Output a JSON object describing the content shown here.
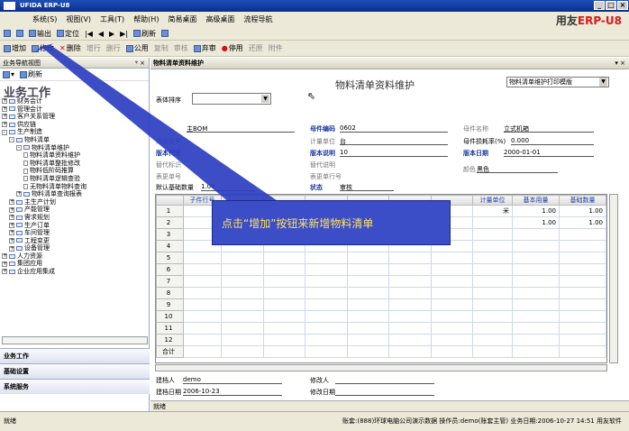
{
  "window": {
    "title": "UFIDA ERP-U8",
    "brand_prefix": "用友",
    "brand_main": "ERP-U8"
  },
  "menu": [
    "系统(S)",
    "视图(V)",
    "工具(T)",
    "帮助(H)",
    "简易桌面",
    "高级桌面",
    "流程导航"
  ],
  "toolbar1": [
    "输出",
    "定位",
    "刷新"
  ],
  "toolbar2": [
    "增加",
    "修改",
    "删除",
    "增行",
    "删行",
    "公用",
    "复制",
    "审核",
    "弃审",
    "停用",
    "还原",
    "附件"
  ],
  "left": {
    "header": "业务导航视图",
    "refresh": "刷新",
    "title": "业务工作",
    "tree": [
      {
        "label": "财务会计",
        "indent": 0,
        "box": "+"
      },
      {
        "label": "管理会计",
        "indent": 0,
        "box": "+"
      },
      {
        "label": "客户关系管理",
        "indent": 0,
        "box": "+"
      },
      {
        "label": "供应链",
        "indent": 0,
        "box": "+"
      },
      {
        "label": "生产制造",
        "indent": 0,
        "box": "-"
      },
      {
        "label": "物料清单",
        "indent": 1,
        "box": "-"
      },
      {
        "label": "物料清单维护",
        "indent": 2,
        "box": "-"
      },
      {
        "label": "物料清单资料维护",
        "indent": 3,
        "box": ""
      },
      {
        "label": "物料清单整批修改",
        "indent": 3,
        "box": ""
      },
      {
        "label": "物料低阶码推算",
        "indent": 3,
        "box": ""
      },
      {
        "label": "物料清单逻辑查验",
        "indent": 3,
        "box": ""
      },
      {
        "label": "无物料清单物料查询",
        "indent": 3,
        "box": ""
      },
      {
        "label": "物料清单查询报表",
        "indent": 2,
        "box": "+"
      },
      {
        "label": "主生产计划",
        "indent": 1,
        "box": "+"
      },
      {
        "label": "产能管理",
        "indent": 1,
        "box": "+"
      },
      {
        "label": "需求规划",
        "indent": 1,
        "box": "+"
      },
      {
        "label": "生产订单",
        "indent": 1,
        "box": "+"
      },
      {
        "label": "车间管理",
        "indent": 1,
        "box": "+"
      },
      {
        "label": "工程变更",
        "indent": 1,
        "box": "+"
      },
      {
        "label": "设备管理",
        "indent": 1,
        "box": "+"
      },
      {
        "label": "人力资源",
        "indent": 0,
        "box": "+"
      },
      {
        "label": "集团应用",
        "indent": 0,
        "box": "+"
      },
      {
        "label": "企业应用集成",
        "indent": 0,
        "box": "+"
      }
    ],
    "tabs": [
      "业务工作",
      "基础设置",
      "系统服务"
    ]
  },
  "form": {
    "tab": "物料清单资料维护",
    "title": "物料清单资料维护",
    "print_template": "物料清单维护打印模版",
    "sort_label": "表体排序",
    "fields": {
      "bom_type": "主BOM",
      "spec": "规格型号",
      "version_code": "版本代号",
      "alt_flag": "替代标识",
      "parent_no": "表更单号",
      "default_qty_label": "默认基础数量",
      "default_qty": "1.00",
      "code_label": "母件编码",
      "code": "0602",
      "unit_label": "计量单位",
      "unit": "台",
      "ver_desc_label": "版本说明",
      "ver_desc": "10",
      "alt_desc_label": "替代说明",
      "seq_label": "表更单行号",
      "status_label": "状态",
      "status": "审核",
      "name_label": "母件名称",
      "name": "立式机箱",
      "loss_label": "母件损耗率(%)",
      "loss": "0.000",
      "date_label": "版本日期",
      "date": "2000-01-01",
      "color_label": "颜色",
      "color": "黑色"
    },
    "columns": [
      "",
      "子件行号",
      "",
      "",
      "",
      "",
      "",
      "",
      "",
      "基本用量",
      "基础数量"
    ],
    "rows": [
      {
        "n": "1",
        "c0": "",
        "unit": "米",
        "base": "1.00",
        "qty": "1.00"
      },
      {
        "n": "2",
        "c0": "",
        "unit": "",
        "base": "1.00",
        "qty": "1.00"
      },
      {
        "n": "3"
      },
      {
        "n": "4"
      },
      {
        "n": "5"
      },
      {
        "n": "6"
      },
      {
        "n": "7"
      },
      {
        "n": "8"
      },
      {
        "n": "9"
      },
      {
        "n": "10"
      },
      {
        "n": "11"
      },
      {
        "n": "12"
      },
      {
        "n": "合计"
      }
    ],
    "unit_col": "计量单位",
    "creator_label": "建档人",
    "creator": "demo",
    "create_date_label": "建档日期",
    "create_date": "2006-10-23",
    "modifier_label": "修改人",
    "modify_date_label": "修改日期"
  },
  "callout": "点击“增加”按钮来新增物料清单",
  "status": {
    "left": "就绪",
    "right_bar": "就绪",
    "account": "账套:(888)环球电脑公司演示数据",
    "operator": "操作员:demo(账套主管)",
    "bizdate": "业务日期:2006-10-27 14:51",
    "brand": "用友软件"
  },
  "colors": {
    "title": "#0a2f8a",
    "callout": "#3b4ec8",
    "callout_text": "#ffe060"
  }
}
